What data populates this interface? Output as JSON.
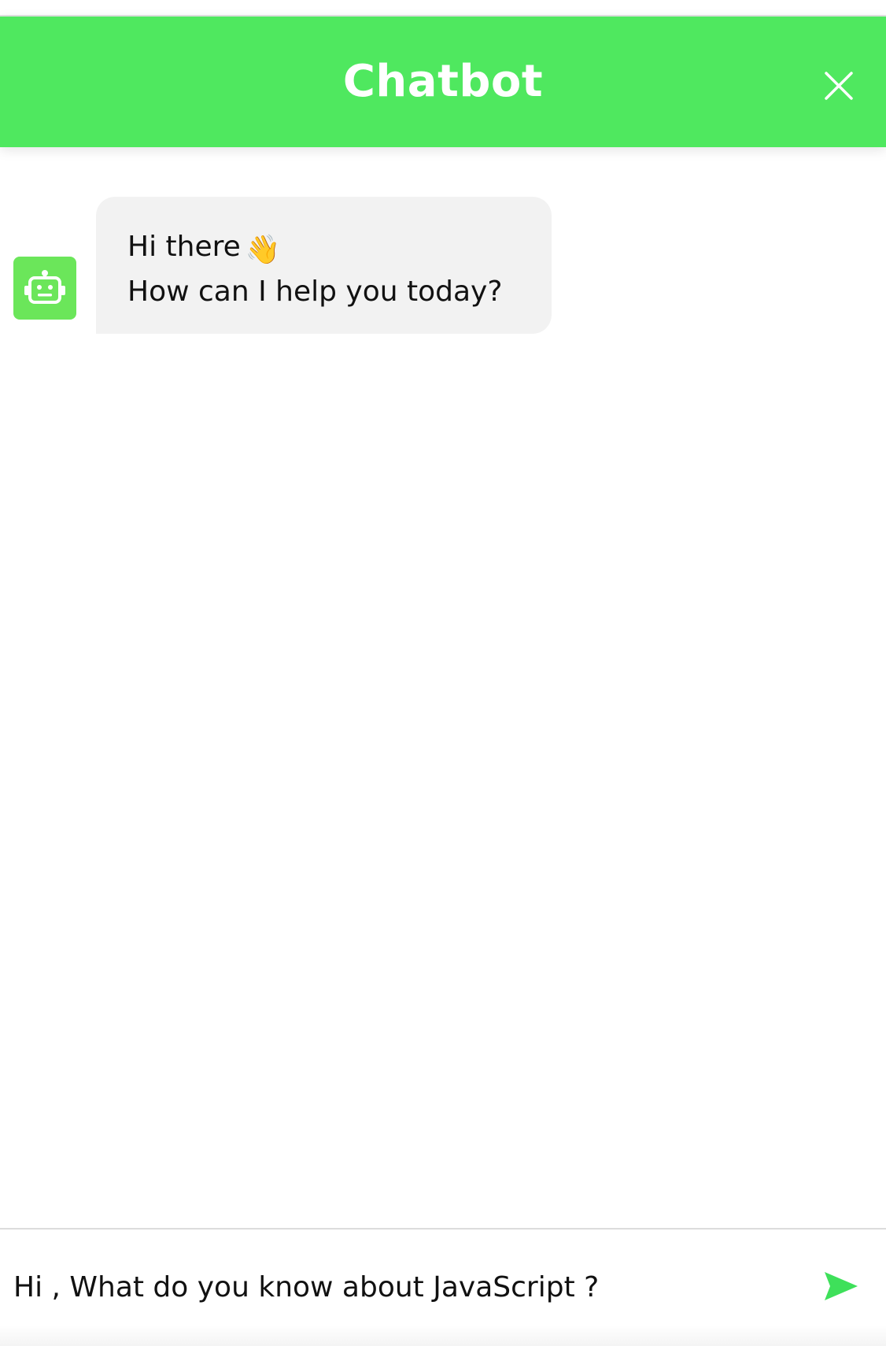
{
  "header": {
    "title": "Chatbot",
    "close_icon": "close-icon",
    "background_color": "#4fe85f"
  },
  "messages": [
    {
      "sender": "bot",
      "avatar_icon": "robot-icon",
      "lines": [
        "Hi there",
        "How can I help you today?"
      ],
      "emoji": "👋",
      "emoji_icon": "waving-hand-icon"
    }
  ],
  "composer": {
    "input_value": "Hi , What do you know about JavaScript ?",
    "send_icon": "send-icon",
    "accent_color": "#3ee05a"
  },
  "colors": {
    "bubble_background": "#f2f2f2",
    "avatar_background": "#6be65a"
  }
}
